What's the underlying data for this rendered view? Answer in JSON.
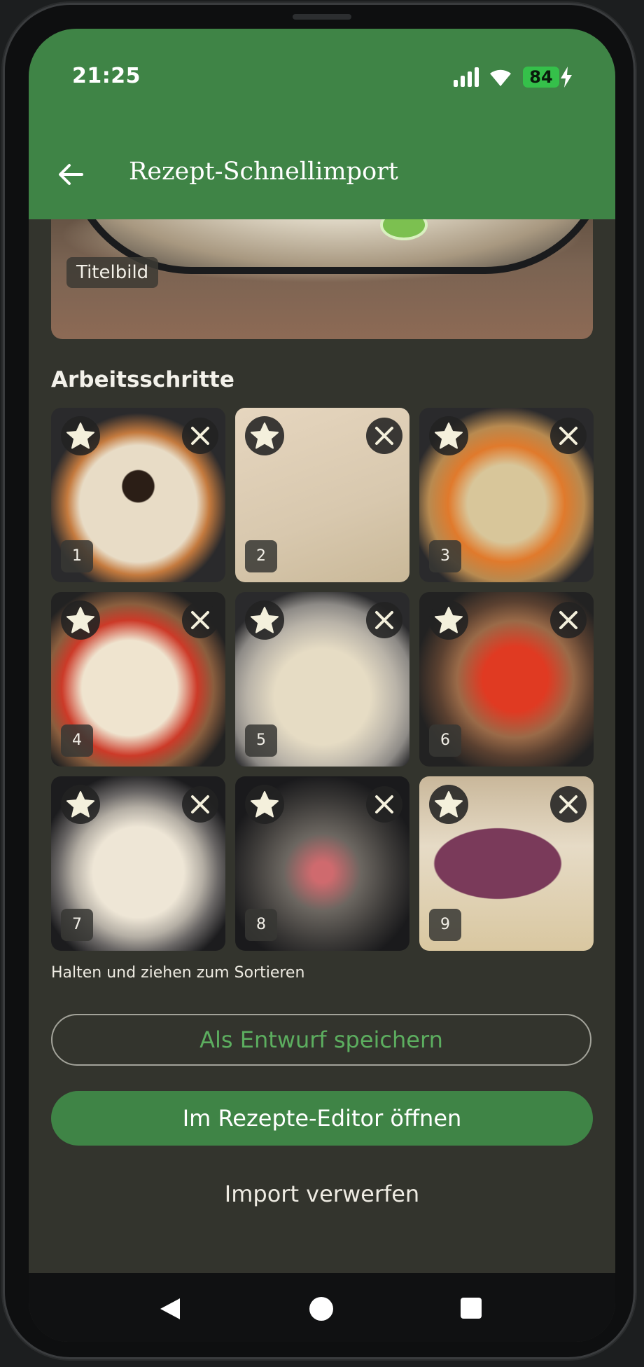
{
  "status_bar": {
    "time": "21:25",
    "battery": "84",
    "icons": [
      "signal-icon",
      "wifi-icon",
      "battery-icon",
      "charging-bolt-icon"
    ]
  },
  "appbar": {
    "title": "Rezept-Schnellimport",
    "back_icon": "arrow-left-icon",
    "color": "#3f8446"
  },
  "hero": {
    "label": "Titelbild"
  },
  "steps": {
    "heading": "Arbeitsschritte",
    "hint": "Halten und ziehen zum Sortieren",
    "items": [
      {
        "number": "1",
        "star_icon": "star-icon",
        "remove_icon": "close-icon"
      },
      {
        "number": "2",
        "star_icon": "star-icon",
        "remove_icon": "close-icon"
      },
      {
        "number": "3",
        "star_icon": "star-icon",
        "remove_icon": "close-icon"
      },
      {
        "number": "4",
        "star_icon": "star-icon",
        "remove_icon": "close-icon"
      },
      {
        "number": "5",
        "star_icon": "star-icon",
        "remove_icon": "close-icon"
      },
      {
        "number": "6",
        "star_icon": "star-icon",
        "remove_icon": "close-icon"
      },
      {
        "number": "7",
        "star_icon": "star-icon",
        "remove_icon": "close-icon"
      },
      {
        "number": "8",
        "star_icon": "star-icon",
        "remove_icon": "close-icon"
      },
      {
        "number": "9",
        "star_icon": "star-icon",
        "remove_icon": "close-icon"
      }
    ]
  },
  "actions": {
    "save_draft": "Als Entwurf speichern",
    "open_editor": "Im Rezepte-Editor öffnen",
    "discard": "Import verwerfen"
  },
  "colors": {
    "accent": "#3f8446",
    "background": "#33342d",
    "outline_text": "#5cae5f"
  },
  "navbar": {
    "icons": [
      "nav-back-icon",
      "nav-home-icon",
      "nav-recents-icon"
    ]
  }
}
